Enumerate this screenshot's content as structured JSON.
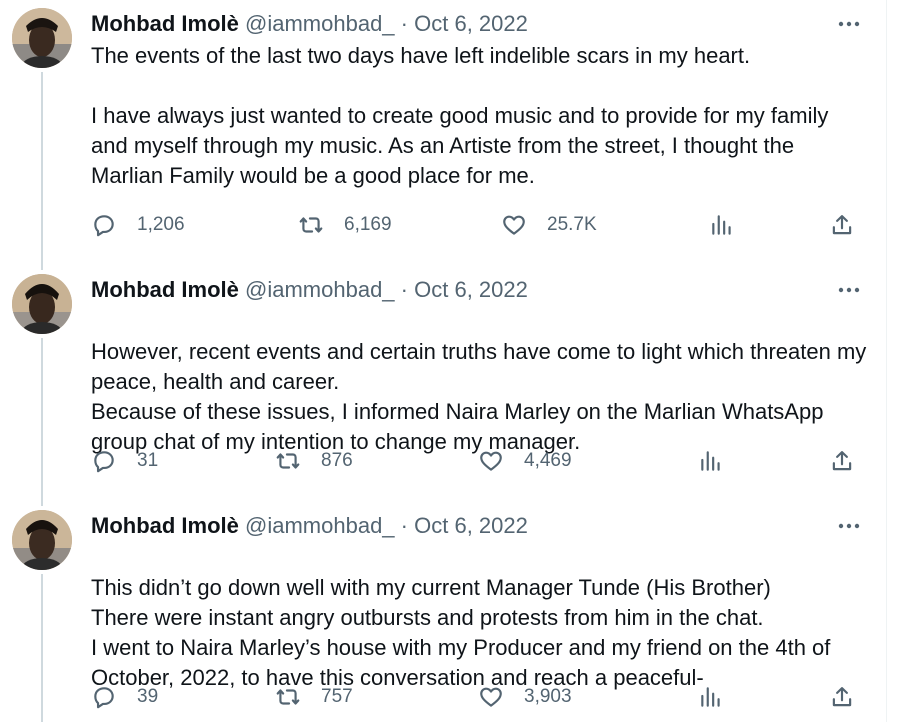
{
  "tweets": [
    {
      "author": {
        "name": "Mohbad Imolè",
        "handle": "@iammohbad_",
        "separator": "·",
        "date": "Oct 6, 2022"
      },
      "paragraphs": [
        "The events of the last two days have left indelible scars in my heart.",
        "I have always just wanted to create good music and to provide for my family and myself through my music. As an Artiste from the street, I thought the Marlian Family would be a good place for me."
      ],
      "counts": {
        "replies": "1,206",
        "retweets": "6,169",
        "likes": "25.7K"
      }
    },
    {
      "author": {
        "name": "Mohbad Imolè",
        "handle": "@iammohbad_",
        "separator": "·",
        "date": "Oct 6, 2022"
      },
      "paragraphs": [
        "However, recent events and certain truths have come to light which threaten my peace,  health and career.\nBecause of these issues, I informed Naira Marley on the Marlian WhatsApp group chat of my intention to change my manager."
      ],
      "counts": {
        "replies": "31",
        "retweets": "876",
        "likes": "4,469"
      }
    },
    {
      "author": {
        "name": "Mohbad Imolè",
        "handle": "@iammohbad_",
        "separator": "·",
        "date": "Oct 6, 2022"
      },
      "paragraphs": [
        "This didn’t go down well with my current Manager Tunde (His Brother)\nThere were instant angry outbursts and protests from him in the chat.\nI went to Naira Marley’s house with my Producer and my friend on the 4th of October, 2022, to have this conversation and reach a peaceful-"
      ],
      "counts": {
        "replies": "39",
        "retweets": "757",
        "likes": "3,903"
      }
    }
  ],
  "icons": {
    "reply": "reply-icon",
    "retweet": "retweet-icon",
    "like": "heart-icon",
    "views": "views-icon",
    "share": "share-icon",
    "more": "more-icon"
  },
  "colors": {
    "text": "#0f1419",
    "secondary": "#536471",
    "thread_line": "#cfd9de",
    "border": "#eff3f4"
  }
}
